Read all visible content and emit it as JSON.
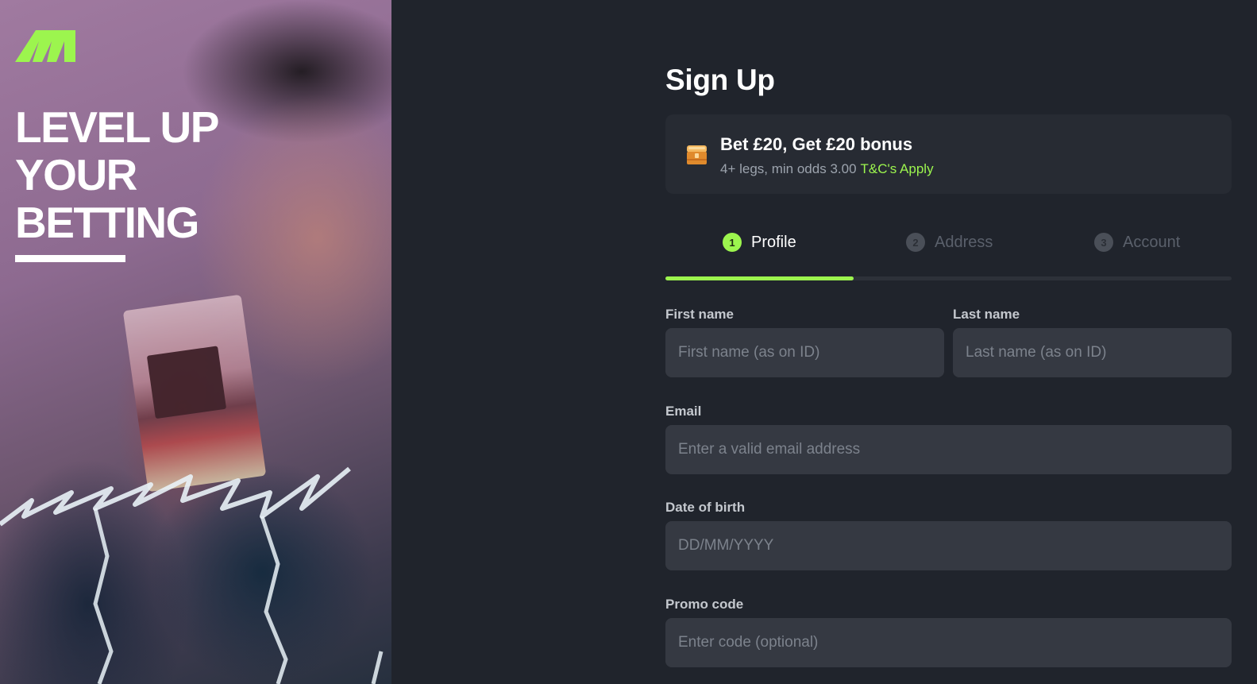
{
  "hero": {
    "headline_line1": "LEVEL UP",
    "headline_line2": "YOUR",
    "headline_line3": "BETTING",
    "logo_icon": "m-logo-icon"
  },
  "signup": {
    "title": "Sign Up"
  },
  "promo": {
    "icon": "treasure-chest-icon",
    "title": "Bet £20, Get £20 bonus",
    "subtitle": "4+ legs, min odds 3.00",
    "terms_link": "T&C's Apply"
  },
  "steps": {
    "items": [
      {
        "number": "1",
        "label": "Profile",
        "state": "active"
      },
      {
        "number": "2",
        "label": "Address",
        "state": "inactive"
      },
      {
        "number": "3",
        "label": "Account",
        "state": "inactive"
      }
    ],
    "progress_fraction": 0.333
  },
  "form": {
    "first_name": {
      "label": "First name",
      "placeholder": "First name (as on ID)",
      "value": ""
    },
    "last_name": {
      "label": "Last name",
      "placeholder": "Last name (as on ID)",
      "value": ""
    },
    "email": {
      "label": "Email",
      "placeholder": "Enter a valid email address",
      "value": ""
    },
    "dob": {
      "label": "Date of birth",
      "placeholder": "DD/MM/YYYY",
      "value": ""
    },
    "promo_code": {
      "label": "Promo code",
      "placeholder": "Enter code (optional)",
      "value": ""
    }
  },
  "colors": {
    "accent": "#9cf54e",
    "background": "#20242c",
    "card": "#272b33",
    "input": "#353942"
  }
}
